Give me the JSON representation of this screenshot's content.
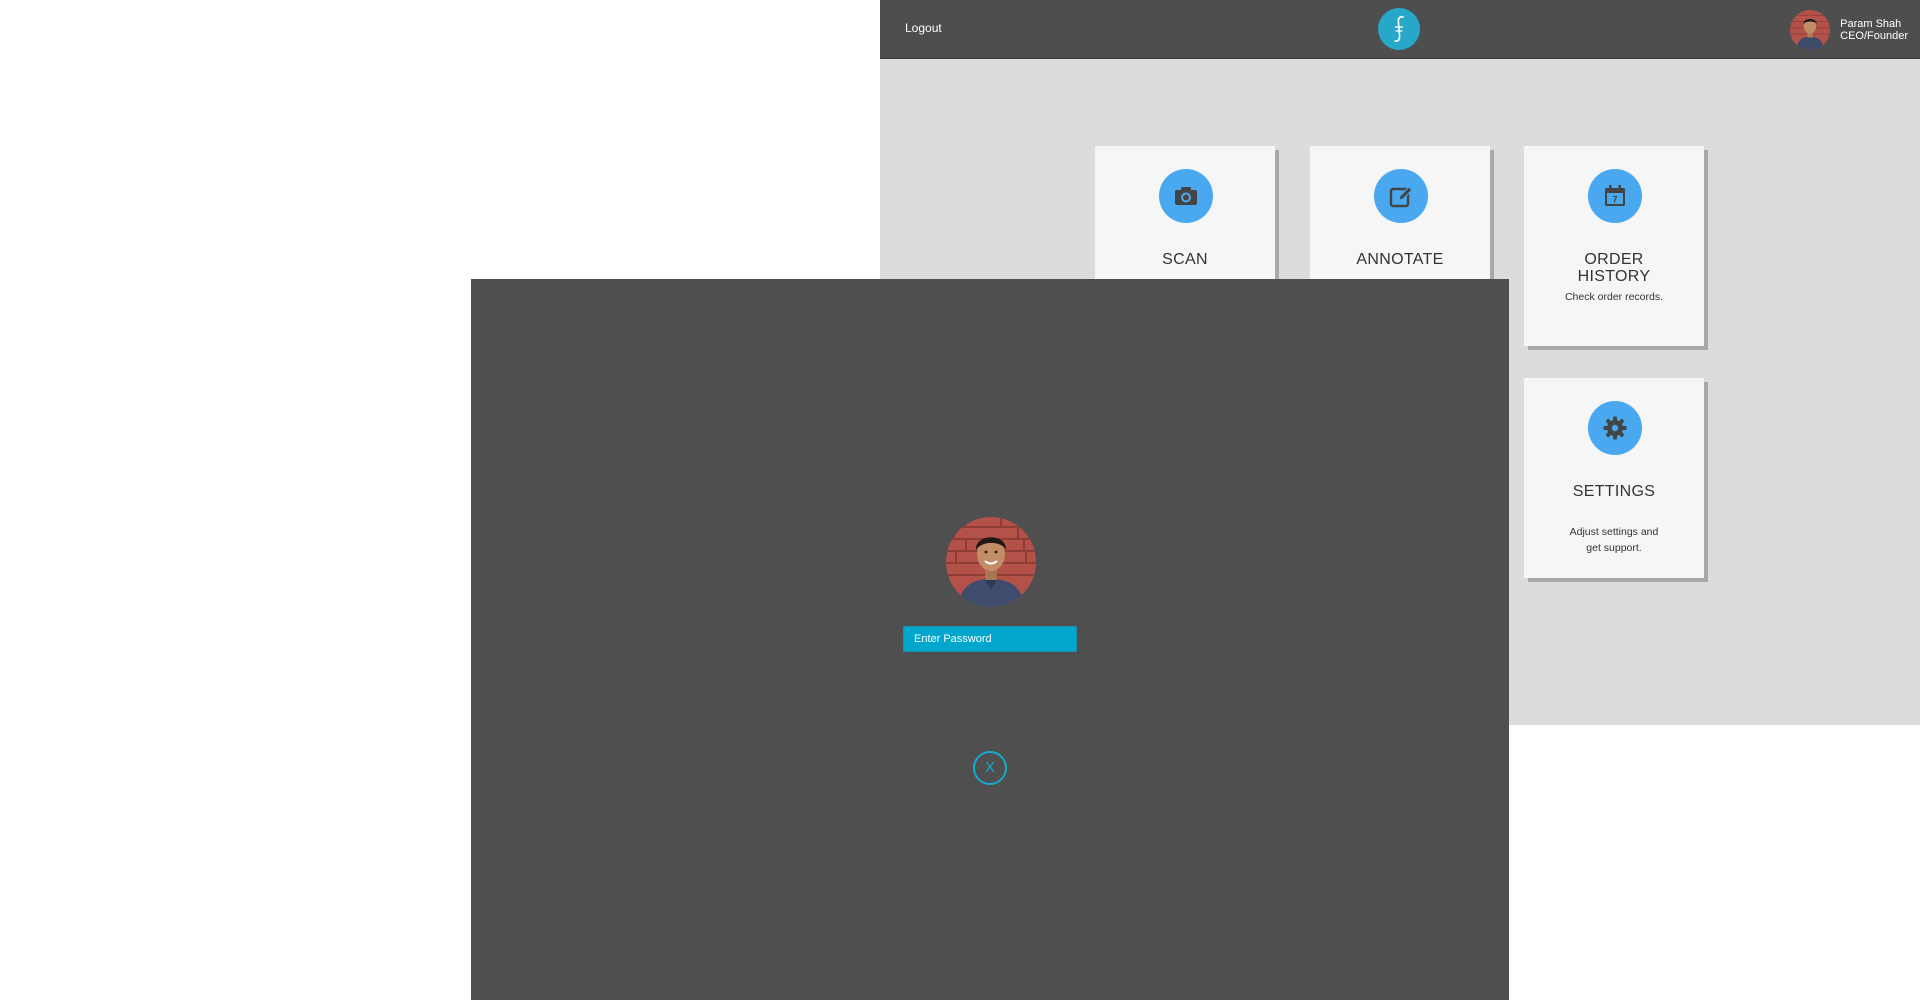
{
  "header": {
    "logout_label": "Logout",
    "brand_logo_glyph": "ʃ",
    "user": {
      "name": "Param Shah",
      "role": "CEO/Founder"
    }
  },
  "tiles": [
    {
      "key": "scan",
      "icon": "camera-icon",
      "title_lines": [
        "SCAN"
      ],
      "description": ""
    },
    {
      "key": "annotate",
      "icon": "edit-icon",
      "title_lines": [
        "ANNOTATE"
      ],
      "description": ""
    },
    {
      "key": "order-history",
      "icon": "calendar-icon",
      "calendar_day": "7",
      "title_lines": [
        "ORDER",
        "HISTORY"
      ],
      "description": "Check order records."
    },
    {
      "key": "settings",
      "icon": "gear-icon",
      "title_lines": [
        "SETTINGS"
      ],
      "description_lines": [
        "Adjust settings and",
        "get support."
      ]
    }
  ],
  "lock": {
    "password_placeholder": "Enter Password",
    "close_label": "X"
  },
  "colors": {
    "topbar": "#4e4e4e",
    "dashboard_bg": "#dcdcdc",
    "tile_bg": "#f6f6f6",
    "tile_icon": "#4aa8f0",
    "brand": "#27a8c8",
    "overlay_bg": "#4f4f4f",
    "input_bg": "#00a6cb",
    "close_accent": "#14a9d0"
  }
}
